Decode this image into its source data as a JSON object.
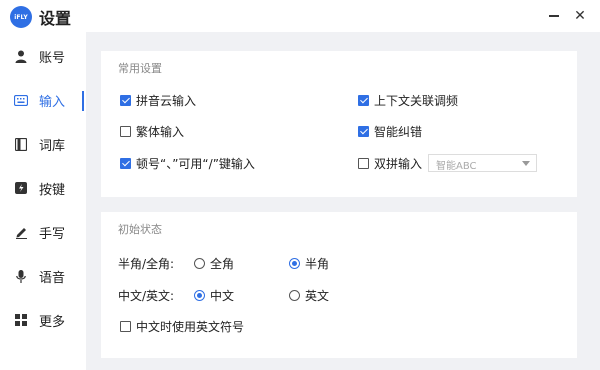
{
  "window": {
    "logo_text": "iFLY",
    "title": "设置",
    "minimize_icon": "minimize-icon",
    "close_icon": "close-icon",
    "close_glyph": "✕"
  },
  "sidebar": {
    "active_index": 1,
    "accent_color": "#2f6fe4",
    "items": [
      {
        "label": "账号",
        "icon": "user-icon"
      },
      {
        "label": "输入",
        "icon": "keyboard-icon"
      },
      {
        "label": "词库",
        "icon": "book-icon"
      },
      {
        "label": "按键",
        "icon": "key-icon"
      },
      {
        "label": "手写",
        "icon": "pen-icon"
      },
      {
        "label": "语音",
        "icon": "microphone-icon"
      },
      {
        "label": "更多",
        "icon": "grid-icon"
      }
    ]
  },
  "common": {
    "title": "常用设置",
    "pinyin_cloud": {
      "label": "拼音云输入",
      "checked": true
    },
    "context_freq": {
      "label": "上下文关联调频",
      "checked": true
    },
    "traditional": {
      "label": "繁体输入",
      "checked": false
    },
    "smart_correct": {
      "label": "智能纠错",
      "checked": true
    },
    "punct_input": {
      "label": "顿号“、”可用“/”键输入",
      "checked": true
    },
    "shuangpin": {
      "label": "双拼输入",
      "checked": false
    },
    "shuangpin_scheme": {
      "value": "智能ABC"
    }
  },
  "initial": {
    "title": "初始状态",
    "width_label": "半角/全角:",
    "width_options": [
      {
        "label": "全角",
        "selected": false
      },
      {
        "label": "半角",
        "selected": true
      }
    ],
    "lang_label": "中文/英文:",
    "lang_options": [
      {
        "label": "中文",
        "selected": true
      },
      {
        "label": "英文",
        "selected": false
      }
    ],
    "english_punct": {
      "label": "中文时使用英文符号",
      "checked": false
    }
  }
}
